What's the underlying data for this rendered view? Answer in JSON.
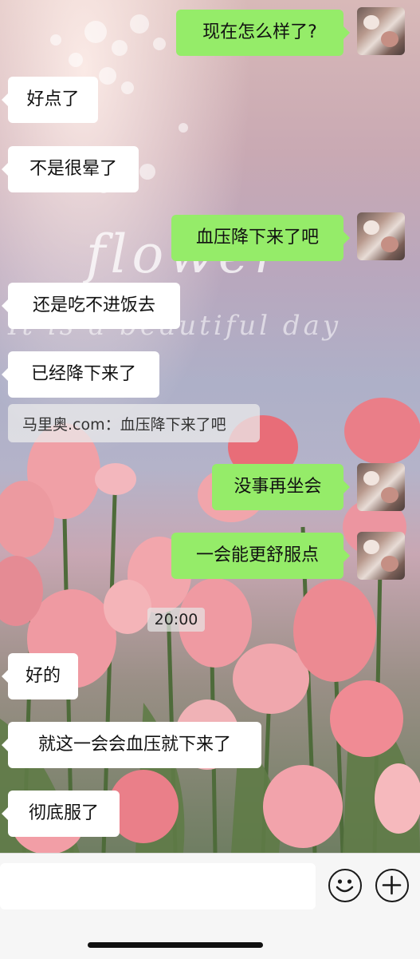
{
  "wallpaper": {
    "title_text": "flower",
    "subtitle_text": "It is a beautiful day"
  },
  "messages": [
    {
      "side": "out",
      "text": "现在怎么样了?"
    },
    {
      "side": "in",
      "text": "好点了"
    },
    {
      "side": "in",
      "text": "不是很晕了"
    },
    {
      "side": "out",
      "text": "血压降下来了吧"
    },
    {
      "side": "in",
      "text": "还是吃不进饭去"
    },
    {
      "side": "in",
      "text": "已经降下来了"
    },
    {
      "side": "quote",
      "text": "马里奥.com：血压降下来了吧"
    },
    {
      "side": "out",
      "text": "没事再坐会"
    },
    {
      "side": "out",
      "text": "一会能更舒服点"
    },
    {
      "side": "time",
      "text": "20:00"
    },
    {
      "side": "in",
      "text": "好的"
    },
    {
      "side": "in",
      "text": "就这一会会血压就下来了"
    },
    {
      "side": "in",
      "text": "彻底服了"
    }
  ],
  "input_bar": {
    "placeholder": "",
    "emoji_icon": "smiley-face-icon",
    "plus_icon": "plus-icon"
  },
  "colors": {
    "outgoing_bubble": "#95ec69",
    "incoming_bubble": "#ffffff",
    "input_bar_bg": "#f6f6f6"
  }
}
